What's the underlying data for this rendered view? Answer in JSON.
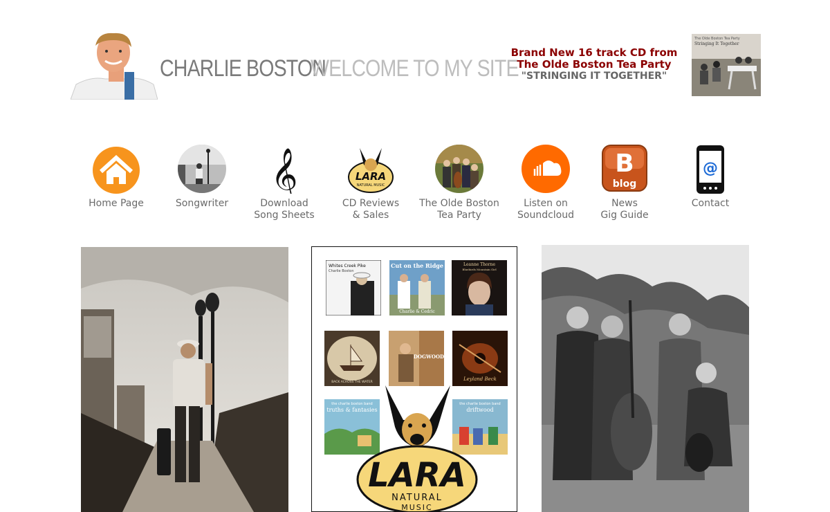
{
  "header": {
    "name": "CHARLIE BOSTON",
    "welcome": "WELCOME TO MY SITE",
    "promo_line1": "Brand New 16 track CD from",
    "promo_line2": "The Olde Boston Tea Party",
    "promo_line3": "\"STRINGING IT TOGETHER\"",
    "album_thumb_text1": "The Olde Boston Tea Party",
    "album_thumb_text2": "Stringing It Together"
  },
  "nav": [
    {
      "label": "Home Page",
      "icon": "house-icon"
    },
    {
      "label": "Songwriter",
      "icon": "songwriter-photo-icon"
    },
    {
      "label": "Download\nSong Sheets",
      "icon": "treble-clef-icon"
    },
    {
      "label": "CD Reviews\n& Sales",
      "icon": "lara-logo-icon"
    },
    {
      "label": "The Olde Boston\nTea Party",
      "icon": "band-photo-icon"
    },
    {
      "label": "Listen on\nSoundcloud",
      "icon": "soundcloud-icon"
    },
    {
      "label": "News\nGig Guide",
      "icon": "blogger-icon"
    },
    {
      "label": "Contact",
      "icon": "phone-at-icon"
    }
  ],
  "icons": {
    "blog_text": "blog",
    "lara_text": "LARA",
    "lara_sub": "NATURAL MUSIC"
  },
  "cds": {
    "cd1_title": "Whites Creek Pike",
    "cd1_artist": "Charlie Boston",
    "cd2_title": "Cut on the Ridge",
    "cd2_artist": "Charlie & Cedric",
    "cd3_title": "Leanne Thorne",
    "cd3_sub": "Bluebirds Mountain Girl",
    "cd4_sub": "BACK ACROSS THE WATER",
    "cd5_title": "DOGWOOD",
    "cd6_title": "Leyland Beck",
    "cd7_title": "the charlie boston band",
    "cd7_sub": "truths & fantasies",
    "cd8_title": "the charlie boston band",
    "cd8_sub": "driftwood"
  },
  "logo": {
    "lara": "LARA",
    "natural": "NATURAL",
    "music": "MUSIC"
  },
  "colors": {
    "accent_orange": "#f7941d",
    "promo_red": "#8b0000",
    "text_grey": "#6a6a6a",
    "lara_yellow": "#f6d77a"
  }
}
